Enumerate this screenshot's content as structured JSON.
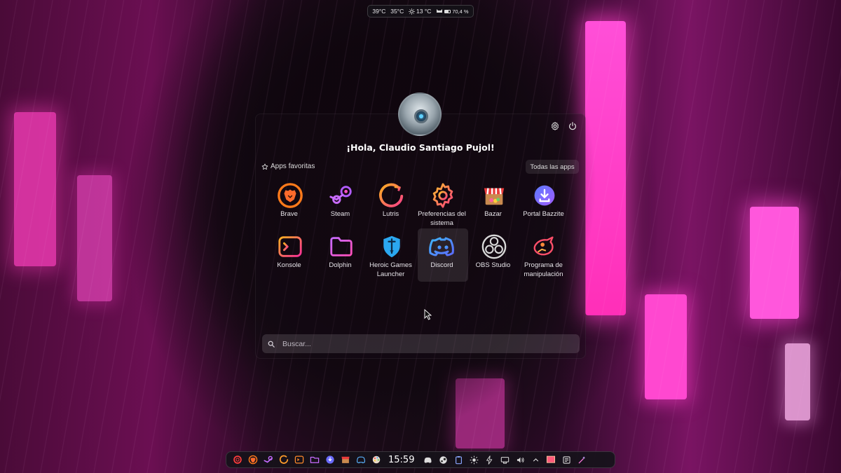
{
  "top_widget": {
    "temp_1": "39°C",
    "temp_2": "35°C",
    "weather": "13 °C",
    "battery": "70,4 %",
    "battery_fraction": 0.704,
    "icons": [
      "sun-icon",
      "cat-icon",
      "battery-icon"
    ]
  },
  "user": {
    "greeting": "¡Hola, Claudio Santiago Pujol!",
    "avatar_icon": "robot-avatar"
  },
  "launcher": {
    "favorites_label": "Apps favoritas",
    "all_apps_label": "Todas las apps",
    "search_placeholder": "Buscar...",
    "header_icons": [
      "gear-icon",
      "power-icon"
    ],
    "apps": [
      {
        "name": "Brave",
        "icon": "brave-icon"
      },
      {
        "name": "Steam",
        "icon": "steam-icon"
      },
      {
        "name": "Lutris",
        "icon": "lutris-icon"
      },
      {
        "name": "Preferencias del sistema",
        "icon": "settings-gear-icon"
      },
      {
        "name": "Bazar",
        "icon": "bazar-shop-icon"
      },
      {
        "name": "Portal Bazzite",
        "icon": "download-portal-icon"
      },
      {
        "name": "Konsole",
        "icon": "terminal-icon"
      },
      {
        "name": "Dolphin",
        "icon": "folder-icon"
      },
      {
        "name": "Heroic Games Launcher",
        "icon": "heroic-shield-icon"
      },
      {
        "name": "Discord",
        "icon": "discord-icon",
        "selected": true
      },
      {
        "name": "OBS Studio",
        "icon": "obs-icon"
      },
      {
        "name": "Programa de manipulación",
        "icon": "gimp-icon"
      }
    ]
  },
  "taskbar": {
    "clock": "15:59",
    "launchers": [
      "launcher-ring-icon",
      "brave-icon",
      "steam-icon",
      "lutris-icon",
      "terminal-icon",
      "folder-icon",
      "portal-icon",
      "bazar-icon",
      "discord-icon",
      "palette-icon"
    ],
    "tray": [
      "discord-tray-icon",
      "steam-tray-icon",
      "clipboard-icon",
      "brightness-icon",
      "bolt-icon",
      "network-icon",
      "volume-icon",
      "chevron-up-icon",
      "desktop-icon",
      "notes-icon",
      "magic-icon"
    ]
  },
  "colors": {
    "accent": "#ff3fc4",
    "panel": "#1a0e18",
    "taskbar": "#16121a"
  }
}
